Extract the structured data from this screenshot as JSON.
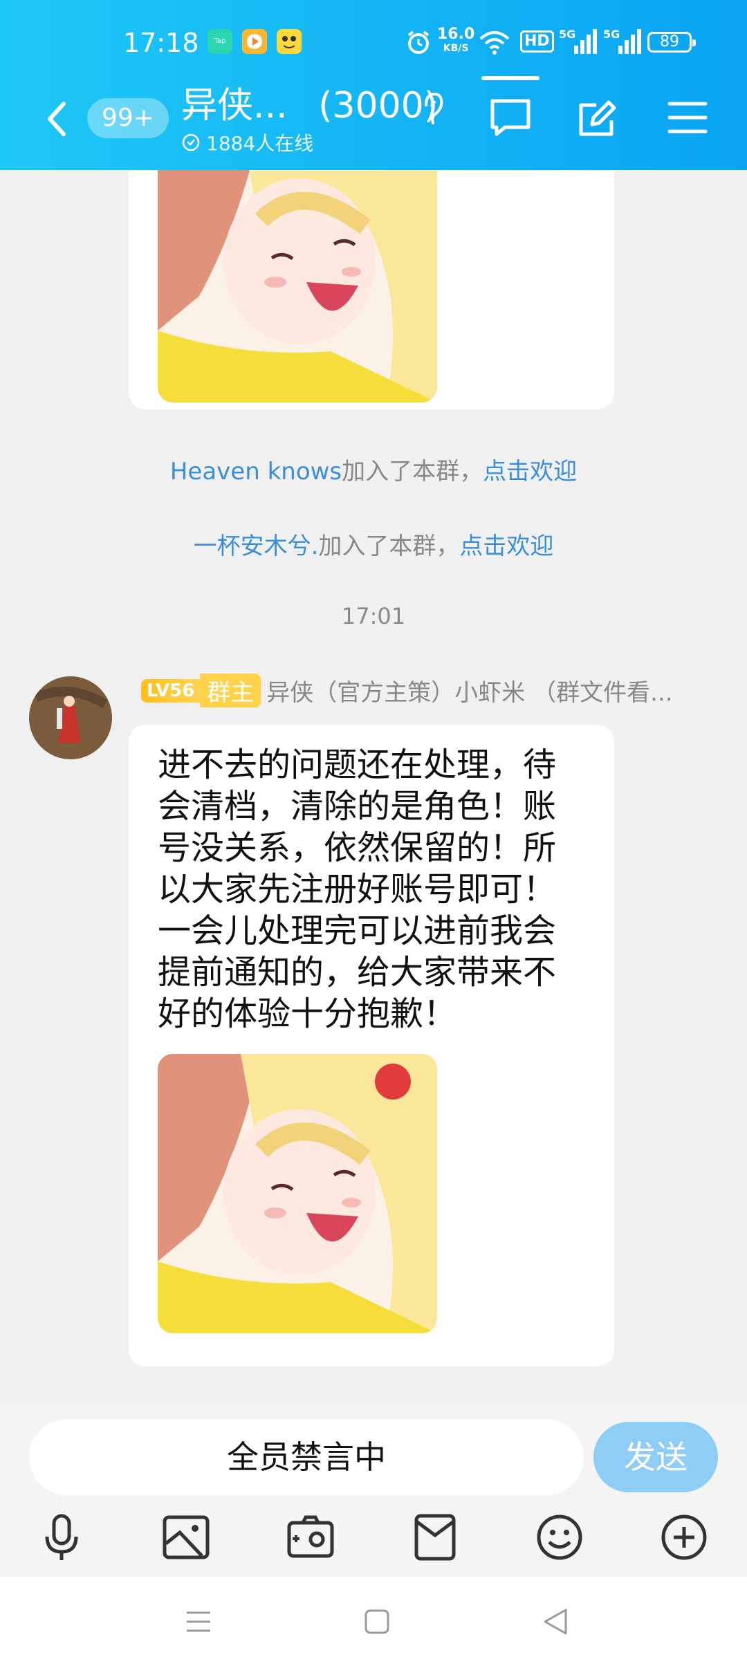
{
  "status_bar": {
    "time": "17:18",
    "net_speed_value": "16.0",
    "net_speed_unit": "KB/S",
    "hd_label": "HD",
    "signal_1": "5G",
    "signal_2": "5G",
    "battery": "89"
  },
  "header": {
    "unread_count": "99+",
    "group_name": "异侠...",
    "member_count": "(3000)",
    "online_text": "1884人在线"
  },
  "messages": {
    "join_1": {
      "name": "Heaven knows",
      "text": "加入了本群，",
      "action": "点击欢迎"
    },
    "join_2": {
      "name": "一杯安木兮.",
      "text": "加入了本群，",
      "action": "点击欢迎"
    },
    "timestamp": "17:01",
    "post": {
      "level": "LV56",
      "role": "群主",
      "sender": "异侠（官方主策）小虾米 （群文件看...",
      "text": "进不去的问题还在处理，待会清档，清除的是角色！账号没关系，依然保留的！所以大家先注册好账号即可！一会儿处理完可以进前我会提前通知的，给大家带来不好的体验十分抱歉！"
    }
  },
  "input": {
    "muted_text": "全员禁言中",
    "send_label": "发送"
  },
  "colors": {
    "header_start": "#1ec8f6",
    "header_end": "#0aa4f3",
    "link": "#3a8fd8",
    "send_button": "#8ecdf6",
    "level_badge": "#ffbe1e"
  }
}
